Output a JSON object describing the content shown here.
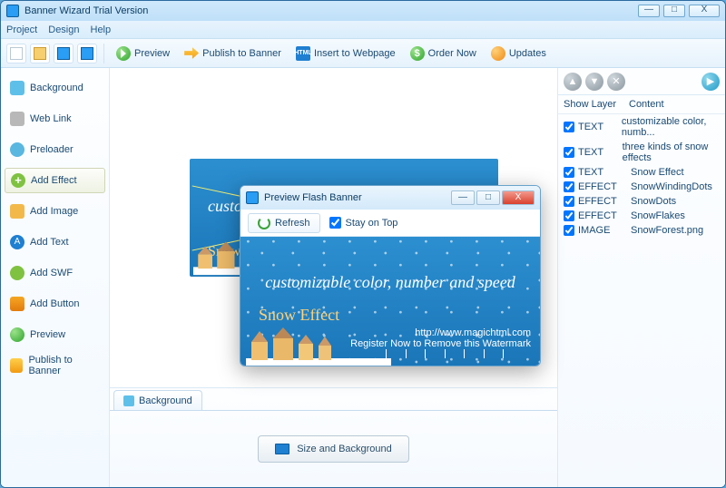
{
  "window": {
    "title": "Banner Wizard Trial Version",
    "minimize": "—",
    "maximize": "□",
    "close": "X"
  },
  "menu": {
    "project": "Project",
    "design": "Design",
    "help": "Help"
  },
  "toolbar": {
    "preview": "Preview",
    "publish": "Publish to Banner",
    "insert": "Insert to Webpage",
    "html_badge": "HTML",
    "order": "Order Now",
    "updates": "Updates"
  },
  "sidebar": {
    "items": [
      {
        "label": "Background",
        "kind": "bg"
      },
      {
        "label": "Web Link",
        "kind": "link"
      },
      {
        "label": "Preloader",
        "kind": "pre"
      },
      {
        "label": "Add Effect",
        "kind": "effect",
        "selected": true
      },
      {
        "label": "Add Image",
        "kind": "img"
      },
      {
        "label": "Add Text",
        "kind": "text",
        "glyph": "A"
      },
      {
        "label": "Add SWF",
        "kind": "swf"
      },
      {
        "label": "Add Button",
        "kind": "btn"
      },
      {
        "label": "Preview",
        "kind": "prev"
      },
      {
        "label": "Publish to Banner",
        "kind": "pub"
      }
    ]
  },
  "canvas": {
    "headline": "custom",
    "subline": "Snow"
  },
  "bottom": {
    "tab": "Background",
    "size_btn": "Size and Background"
  },
  "layers": {
    "head": {
      "c1": "Show Layer",
      "c2": "Content"
    },
    "rows": [
      {
        "type": "TEXT",
        "content": "customizable color, numb..."
      },
      {
        "type": "TEXT",
        "content": "three kinds of snow effects"
      },
      {
        "type": "TEXT",
        "content": "Snow Effect"
      },
      {
        "type": "EFFECT",
        "content": "SnowWindingDots"
      },
      {
        "type": "EFFECT",
        "content": "SnowDots"
      },
      {
        "type": "EFFECT",
        "content": "SnowFlakes"
      },
      {
        "type": "IMAGE",
        "content": "SnowForest.png"
      }
    ]
  },
  "dialog": {
    "title": "Preview Flash Banner",
    "refresh": "Refresh",
    "stay": "Stay on Top",
    "headline": "customizable color, number and speed",
    "subline": "Snow Effect",
    "url": "http://www.magichtml.com",
    "watermark": "Register Now to Remove this Watermark",
    "minimize": "—",
    "maximize": "□",
    "close": "X"
  }
}
